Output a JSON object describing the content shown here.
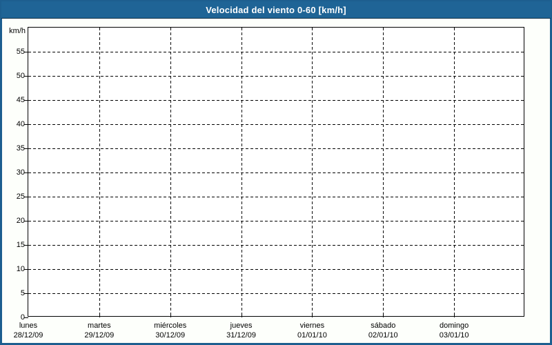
{
  "window": {
    "title": "Velocidad del viento 0-60 [km/h]"
  },
  "colors": {
    "titlebar_bg": "#1f6496",
    "titlebar_text": "#ffffff",
    "frame_border": "#1d5e8f",
    "titlebar_divider": "#0d2c44",
    "background": "#fdfffb",
    "plot_background": "#ffffff",
    "grid_and_text": "#000000"
  },
  "y_axis": {
    "unit_label": "km/h",
    "ticks": [
      0,
      5,
      10,
      15,
      20,
      25,
      30,
      35,
      40,
      45,
      50,
      55
    ],
    "min": 0,
    "max": 60
  },
  "x_axis": {
    "days": [
      {
        "name": "lunes",
        "date": "28/12/09"
      },
      {
        "name": "martes",
        "date": "29/12/09"
      },
      {
        "name": "miércoles",
        "date": "30/12/09"
      },
      {
        "name": "jueves",
        "date": "31/12/09"
      },
      {
        "name": "viernes",
        "date": "01/01/10"
      },
      {
        "name": "sábado",
        "date": "02/01/10"
      },
      {
        "name": "domingo",
        "date": "03/01/10"
      }
    ]
  },
  "chart_data": {
    "type": "line",
    "title": "Velocidad del viento 0-60 [km/h]",
    "ylabel": "km/h",
    "ylim": [
      0,
      60
    ],
    "y_tick_step": 5,
    "categories": [
      "lunes 28/12/09",
      "martes 29/12/09",
      "miércoles 30/12/09",
      "jueves 31/12/09",
      "viernes 01/01/10",
      "sábado 02/01/10",
      "domingo 03/01/10"
    ],
    "series": [],
    "grid": true,
    "grid_style": "dashed",
    "legend": "none"
  }
}
